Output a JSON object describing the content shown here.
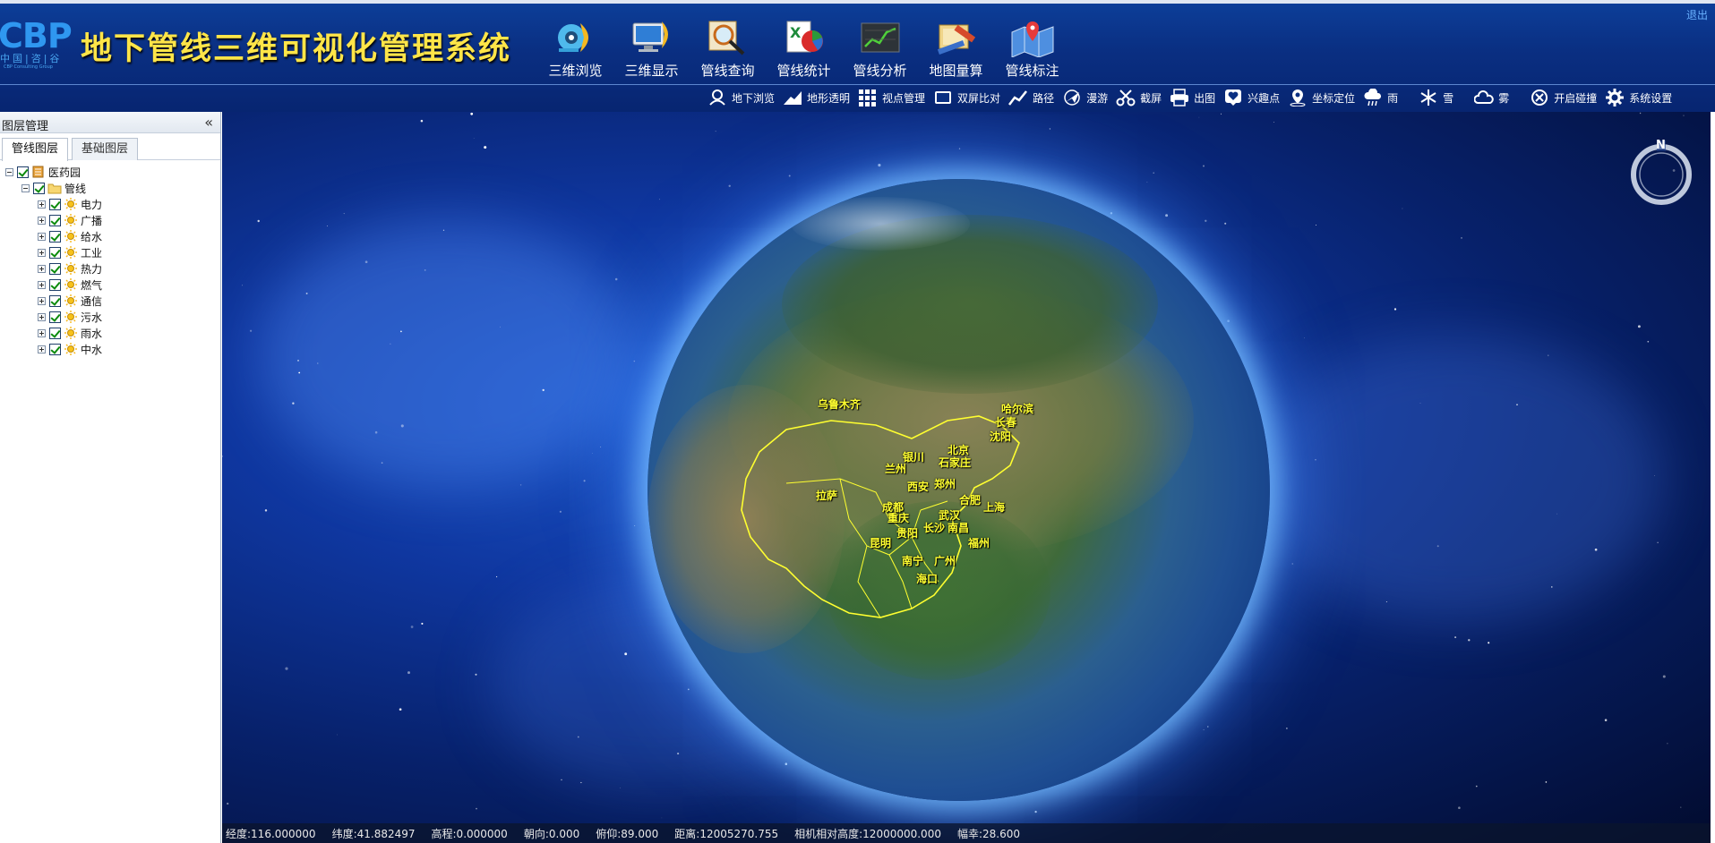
{
  "header": {
    "logo_text": "CBP",
    "logo_cn": "中国|咨|谷",
    "logo_en": "CBP Consulting Group",
    "title": "地下管线三维可视化管理系统",
    "logout": "退出"
  },
  "main_toolbar": [
    {
      "label": "三维浏览",
      "icon": "3d-browse-icon"
    },
    {
      "label": "三维显示",
      "icon": "monitor-icon"
    },
    {
      "label": "管线查询",
      "icon": "magnifier-icon"
    },
    {
      "label": "管线统计",
      "icon": "excel-chart-icon"
    },
    {
      "label": "管线分析",
      "icon": "line-chart-icon"
    },
    {
      "label": "地图量算",
      "icon": "ruler-map-icon"
    },
    {
      "label": "管线标注",
      "icon": "map-pin-icon"
    }
  ],
  "sub_toolbar": [
    {
      "label": "地下浏览",
      "icon": "underground-icon"
    },
    {
      "label": "地形透明",
      "icon": "terrain-icon"
    },
    {
      "label": "视点管理",
      "icon": "grid-icon"
    },
    {
      "label": "双屏比对",
      "icon": "dual-screen-icon"
    },
    {
      "label": "路径",
      "icon": "path-icon"
    },
    {
      "label": "漫游",
      "icon": "plane-icon"
    },
    {
      "label": "截屏",
      "icon": "scissors-icon"
    },
    {
      "label": "出图",
      "icon": "printer-icon"
    },
    {
      "label": "兴趣点",
      "icon": "heart-pin-icon"
    },
    {
      "label": "坐标定位",
      "icon": "locate-icon"
    },
    {
      "label": "雨",
      "icon": "rain-icon"
    },
    {
      "label": "雪",
      "icon": "snow-icon"
    },
    {
      "label": "雾",
      "icon": "fog-icon"
    },
    {
      "label": "开启碰撞",
      "icon": "collision-icon"
    },
    {
      "label": "系统设置",
      "icon": "gear-icon"
    }
  ],
  "sidebar": {
    "title": "图层管理",
    "collapse": "«",
    "tabs": [
      "管线图层",
      "基础图层"
    ],
    "tree": {
      "root": "医药园",
      "group": "管线",
      "layers": [
        "电力",
        "广播",
        "给水",
        "工业",
        "热力",
        "燃气",
        "通信",
        "污水",
        "雨水",
        "中水"
      ]
    }
  },
  "map": {
    "compass_label": "N",
    "cities": [
      "乌鲁木齐",
      "哈尔滨",
      "长春",
      "沈阳",
      "北京",
      "石家庄",
      "银川",
      "兰州",
      "西安",
      "郑州",
      "拉萨",
      "成都",
      "合肥",
      "上海",
      "重庆",
      "武汉",
      "南昌",
      "长沙",
      "贵阳",
      "福州",
      "昆明",
      "南宁",
      "广州",
      "海口"
    ]
  },
  "status": {
    "lon": "经度:116.000000",
    "lat": "纬度:41.882497",
    "elev": "高程:0.000000",
    "heading": "朝向:0.000",
    "pitch": "俯仰:89.000",
    "distance": "距离:12005270.755",
    "cam_height": "相机相对高度:12000000.000",
    "scale": "幅幸:28.600"
  }
}
